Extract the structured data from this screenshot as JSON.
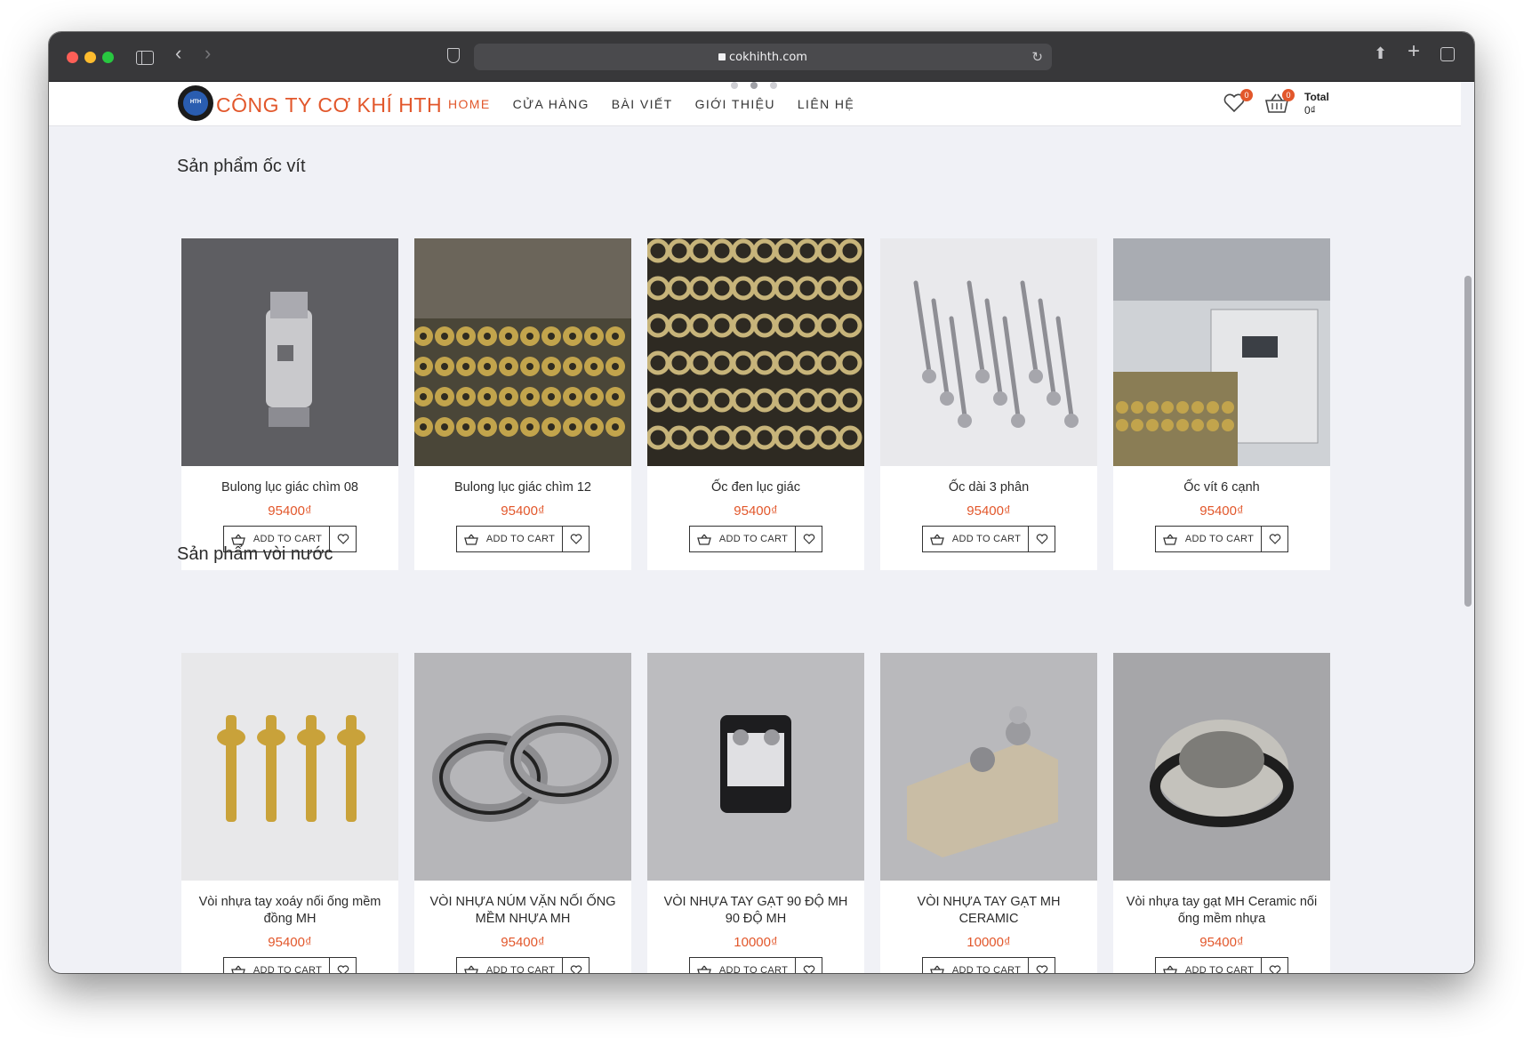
{
  "browser": {
    "url": "cokhihth.com"
  },
  "header": {
    "brand": "CÔNG TY CƠ KHÍ HTH",
    "nav": [
      "HOME",
      "CỬA HÀNG",
      "BÀI VIẾT",
      "GIỚI THIỆU",
      "LIÊN HỆ"
    ],
    "active_nav": "HOME",
    "wishlist_count": "0",
    "cart_count": "0",
    "total_label": "Total",
    "total_value": "0₫"
  },
  "sections": [
    {
      "title": "Sản phẩm ốc vít",
      "products": [
        {
          "name": "Bulong lục giác chìm 08",
          "price": "95400₫",
          "image": "chrome-fitting"
        },
        {
          "name": "Bulong lục giác chìm 12",
          "price": "95400₫",
          "image": "brass-hex-bars"
        },
        {
          "name": "Ốc đen lục giác",
          "price": "95400₫",
          "image": "brass-tubes"
        },
        {
          "name": "Ốc dài 3 phân",
          "price": "95400₫",
          "image": "screws"
        },
        {
          "name": "Ốc vít 6 cạnh",
          "price": "95400₫",
          "image": "factory-machine"
        }
      ]
    },
    {
      "title": "Sản phẩm vòi nước",
      "products": [
        {
          "name": "Vòi nhựa tay xoáy nối ống mềm đồng MH",
          "price": "95400₫",
          "image": "brass-pins"
        },
        {
          "name": "VÒI NHỰA NÚM VẶN NỐI ỐNG MỀM NHỰA MH",
          "price": "95400₫",
          "image": "hex-nuts"
        },
        {
          "name": "VÒI NHỰA TAY GẠT 90 ĐỘ MH 90 ĐỘ MH",
          "price": "10000₫",
          "image": "terminal-block"
        },
        {
          "name": "VÒI NHỰA TAY GẠT MH CERAMIC",
          "price": "10000₫",
          "image": "metal-block"
        },
        {
          "name": "Vòi nhựa tay gạt MH Ceramic nối ống mềm nhựa",
          "price": "95400₫",
          "image": "hex-nut-ring"
        }
      ]
    }
  ],
  "labels": {
    "add_to_cart": "ADD TO CART"
  },
  "colors": {
    "accent": "#e2572b",
    "page_bg": "#f0f1f6"
  }
}
